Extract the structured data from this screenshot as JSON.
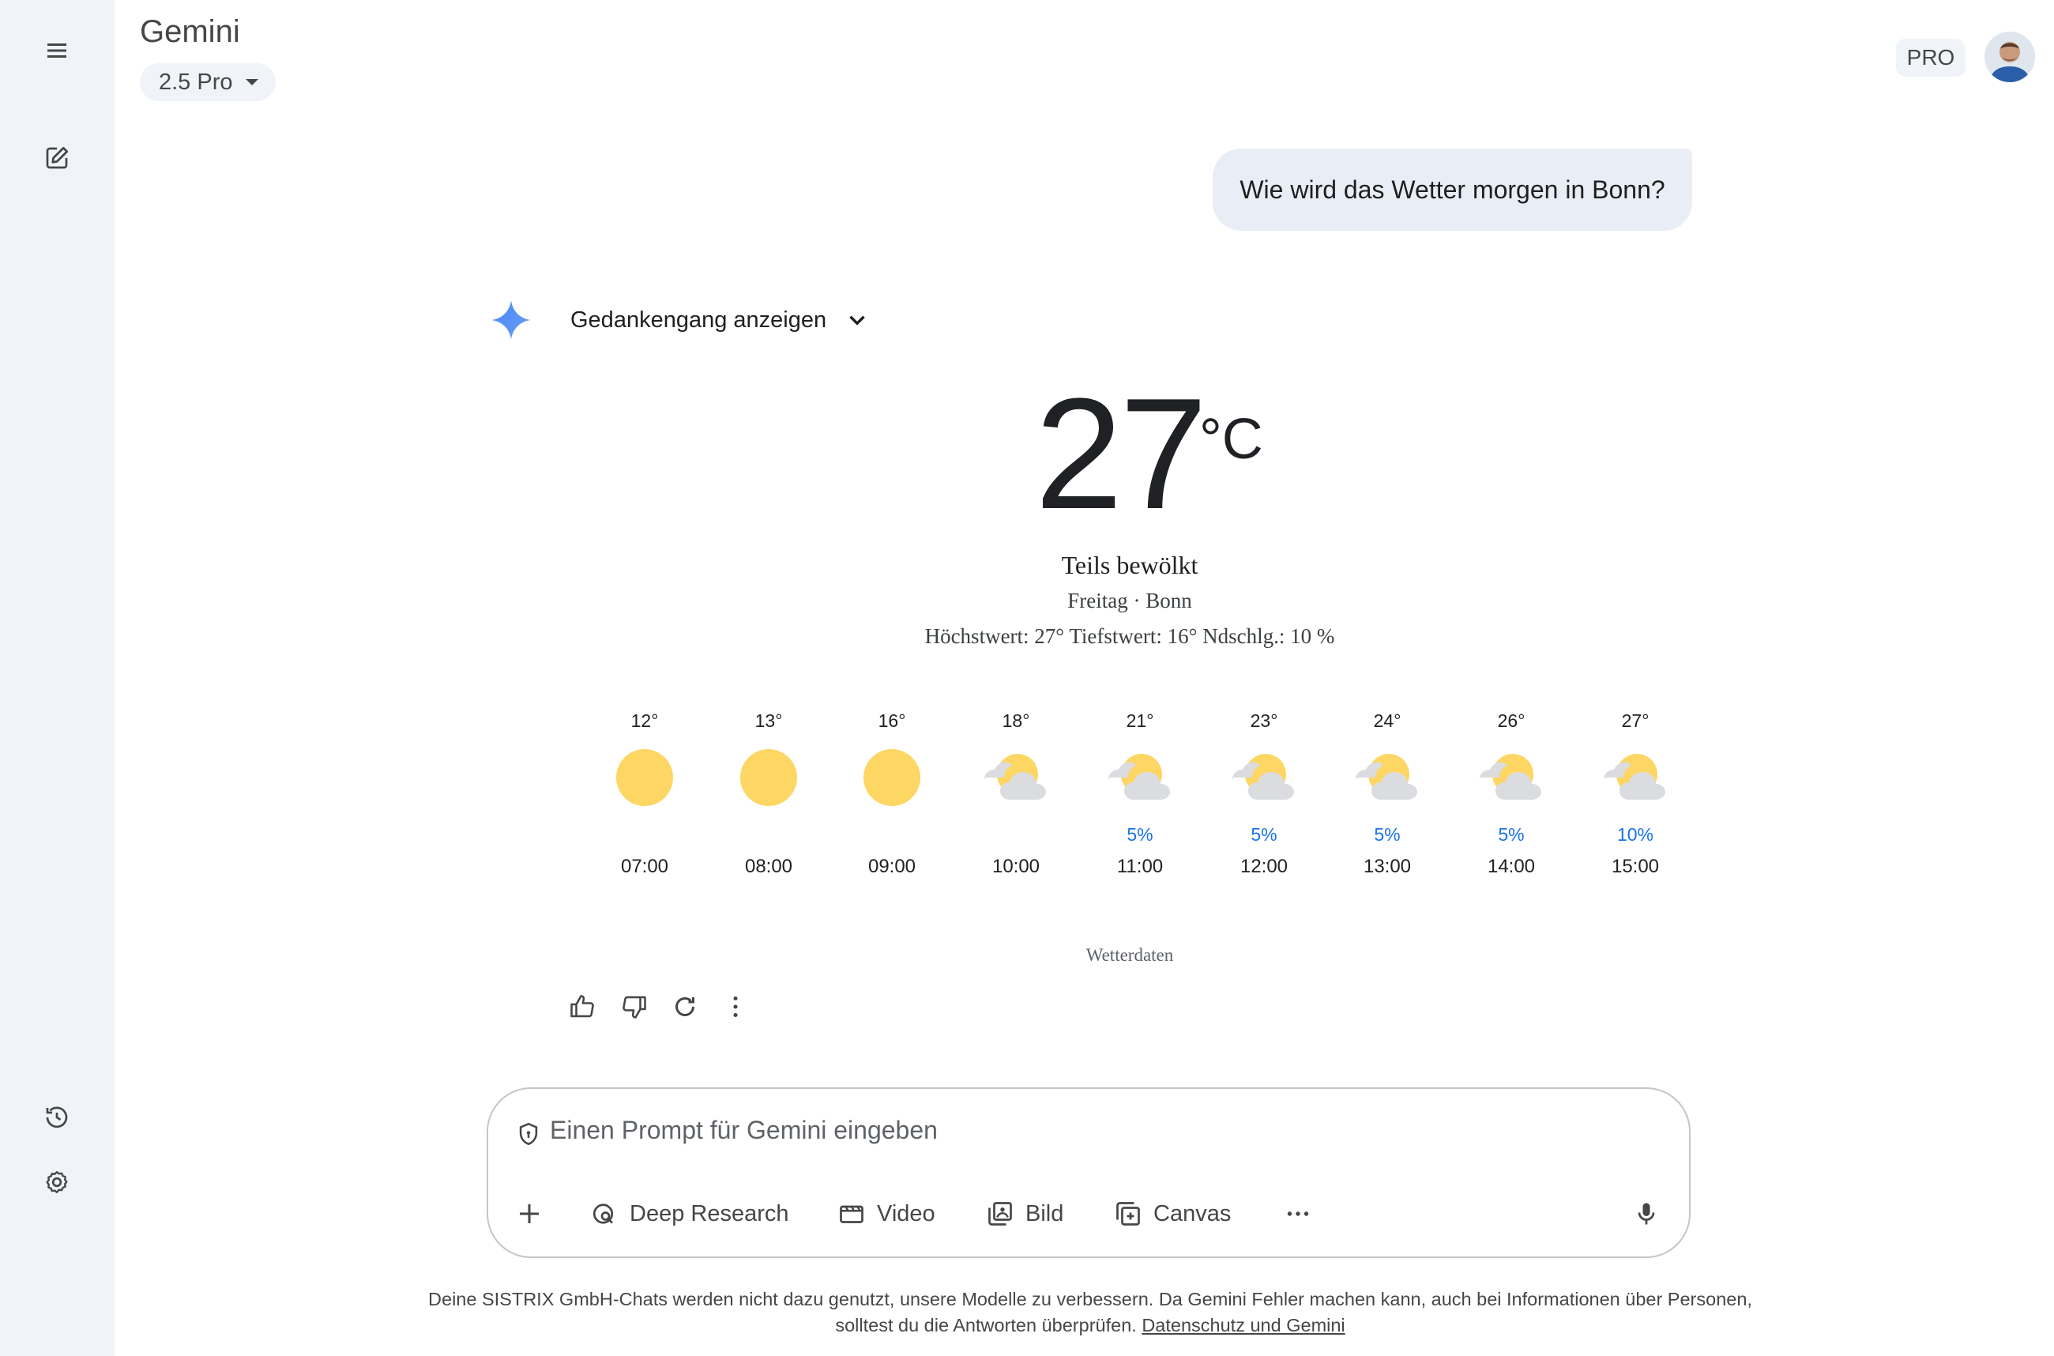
{
  "header": {
    "app_title": "Gemini",
    "model_selector": "2.5 Pro",
    "plan_badge": "PRO"
  },
  "sidebar": {
    "icons": [
      "menu-icon",
      "new-chat-icon",
      "activity-icon",
      "settings-icon"
    ]
  },
  "conversation": {
    "user_message": "Wie wird das Wetter morgen in Bonn?",
    "thinking_toggle": "Gedankengang anzeigen"
  },
  "weather": {
    "temperature": "27",
    "unit": "°C",
    "condition": "Teils bewölkt",
    "day_location": "Freitag · Bonn",
    "stats": "Höchstwert: 27° Tiefstwert: 16°  Ndschlg.: 10 %",
    "source_label": "Wetterdaten",
    "hours": [
      {
        "temp": "12°",
        "icon": "sunny",
        "precip": "",
        "time": "07:00"
      },
      {
        "temp": "13°",
        "icon": "sunny",
        "precip": "",
        "time": "08:00"
      },
      {
        "temp": "16°",
        "icon": "sunny",
        "precip": "",
        "time": "09:00"
      },
      {
        "temp": "18°",
        "icon": "partly-cloudy",
        "precip": "",
        "time": "10:00"
      },
      {
        "temp": "21°",
        "icon": "partly-cloudy",
        "precip": "5%",
        "time": "11:00"
      },
      {
        "temp": "23°",
        "icon": "partly-cloudy",
        "precip": "5%",
        "time": "12:00"
      },
      {
        "temp": "24°",
        "icon": "partly-cloudy",
        "precip": "5%",
        "time": "13:00"
      },
      {
        "temp": "26°",
        "icon": "partly-cloudy",
        "precip": "5%",
        "time": "14:00"
      },
      {
        "temp": "27°",
        "icon": "partly-cloudy",
        "precip": "10%",
        "time": "15:00"
      }
    ]
  },
  "response_actions": [
    "thumbs-up-icon",
    "thumbs-down-icon",
    "regenerate-icon",
    "more-vert-icon"
  ],
  "prompt": {
    "placeholder": "Einen Prompt für Gemini eingeben",
    "value": "",
    "tools": {
      "deep_research": "Deep Research",
      "video": "Video",
      "image": "Bild",
      "canvas": "Canvas"
    }
  },
  "footer": {
    "text": "Deine SISTRIX GmbH-Chats werden nicht dazu genutzt, unsere Modelle zu verbessern. Da Gemini Fehler machen kann, auch bei Informationen über Personen, solltest du die Antworten überprüfen.",
    "link": "Datenschutz und Gemini"
  },
  "colors": {
    "sidebar_bg": "#f0f4f9",
    "bubble_bg": "#e9eef6",
    "precip_blue": "#1a73e8",
    "sun_yellow": "#fdd663",
    "gemini_blue": "#4285f4"
  }
}
